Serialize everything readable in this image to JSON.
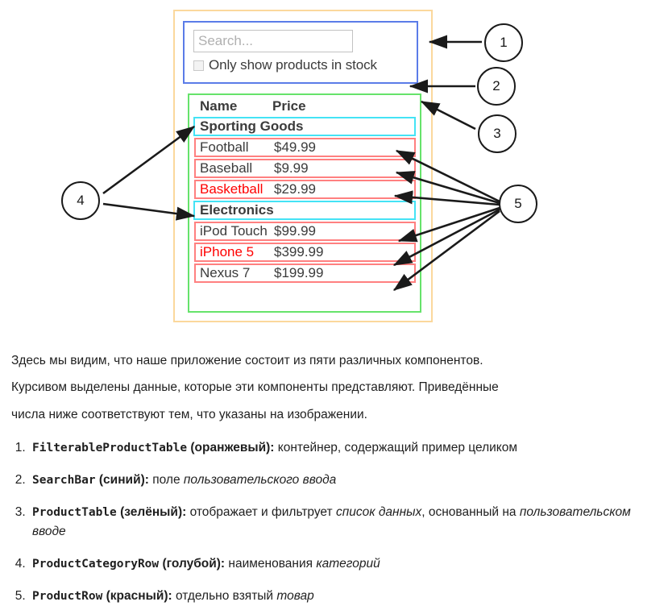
{
  "diagram": {
    "search": {
      "placeholder": "Search...",
      "value": "",
      "checkbox_label": "Only show products in stock",
      "checkbox_checked": false
    },
    "table": {
      "headers": {
        "name": "Name",
        "price": "Price"
      },
      "groups": [
        {
          "category": "Sporting Goods",
          "rows": [
            {
              "name": "Football",
              "price": "$49.99",
              "in_stock": true
            },
            {
              "name": "Baseball",
              "price": "$9.99",
              "in_stock": true
            },
            {
              "name": "Basketball",
              "price": "$29.99",
              "in_stock": false
            }
          ]
        },
        {
          "category": "Electronics",
          "rows": [
            {
              "name": "iPod Touch",
              "price": "$99.99",
              "in_stock": true
            },
            {
              "name": "iPhone 5",
              "price": "$399.99",
              "in_stock": false
            },
            {
              "name": "Nexus 7",
              "price": "$199.99",
              "in_stock": true
            }
          ]
        }
      ]
    },
    "callouts": [
      {
        "number": "1"
      },
      {
        "number": "2"
      },
      {
        "number": "3"
      },
      {
        "number": "4"
      },
      {
        "number": "5"
      }
    ],
    "colors": {
      "filterable_product_table": "#fbd89c",
      "search_bar": "#5b7ce8",
      "product_table": "#66e36b",
      "product_category_row": "#44e3f5",
      "product_row": "#ff8080",
      "out_of_stock_text": "#ff0000",
      "callout_stroke": "#1a1a1a"
    }
  },
  "prose": {
    "paragraphs": [
      "Здесь мы видим, что наше приложение состоит из пяти различных компонентов.",
      "Курсивом выделены данные, которые эти компоненты представляют. Приведённые",
      "числа ниже соответствуют тем, что указаны на изображении."
    ],
    "items": [
      {
        "name": "FilterableProductTable",
        "color": " (оранжевый):",
        "desc_before": " контейнер, содержащий пример целиком",
        "desc_em": "",
        "desc_after": ""
      },
      {
        "name": "SearchBar",
        "color": " (синий):",
        "desc_before": " поле ",
        "desc_em": "пользовательского ввода",
        "desc_after": ""
      },
      {
        "name": "ProductTable",
        "color": " (зелёный):",
        "desc_before": " отображает и фильтрует ",
        "desc_em": "список данных",
        "desc_mid": ", основанный на ",
        "desc_em2": "пользовательском вводе",
        "desc_after": ""
      },
      {
        "name": "ProductCategoryRow",
        "color": " (голубой):",
        "desc_before": " наименования ",
        "desc_em": "категорий",
        "desc_after": ""
      },
      {
        "name": "ProductRow",
        "color": " (красный):",
        "desc_before": " отдельно взятый ",
        "desc_em": "товар",
        "desc_after": ""
      }
    ]
  }
}
